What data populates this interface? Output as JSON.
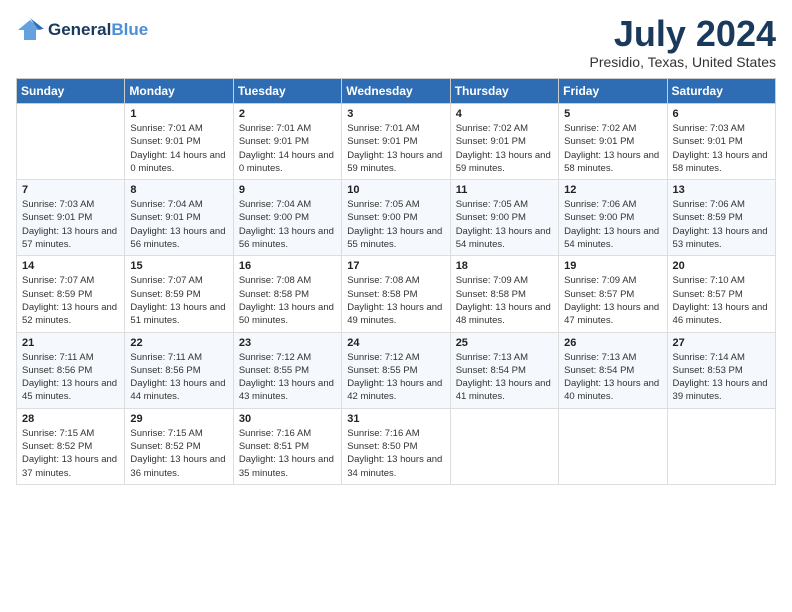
{
  "logo": {
    "line1": "General",
    "line2": "Blue"
  },
  "title": "July 2024",
  "location": "Presidio, Texas, United States",
  "days_of_week": [
    "Sunday",
    "Monday",
    "Tuesday",
    "Wednesday",
    "Thursday",
    "Friday",
    "Saturday"
  ],
  "weeks": [
    [
      {
        "day": "",
        "sunrise": "",
        "sunset": "",
        "daylight": ""
      },
      {
        "day": "1",
        "sunrise": "Sunrise: 7:01 AM",
        "sunset": "Sunset: 9:01 PM",
        "daylight": "Daylight: 14 hours and 0 minutes."
      },
      {
        "day": "2",
        "sunrise": "Sunrise: 7:01 AM",
        "sunset": "Sunset: 9:01 PM",
        "daylight": "Daylight: 14 hours and 0 minutes."
      },
      {
        "day": "3",
        "sunrise": "Sunrise: 7:01 AM",
        "sunset": "Sunset: 9:01 PM",
        "daylight": "Daylight: 13 hours and 59 minutes."
      },
      {
        "day": "4",
        "sunrise": "Sunrise: 7:02 AM",
        "sunset": "Sunset: 9:01 PM",
        "daylight": "Daylight: 13 hours and 59 minutes."
      },
      {
        "day": "5",
        "sunrise": "Sunrise: 7:02 AM",
        "sunset": "Sunset: 9:01 PM",
        "daylight": "Daylight: 13 hours and 58 minutes."
      },
      {
        "day": "6",
        "sunrise": "Sunrise: 7:03 AM",
        "sunset": "Sunset: 9:01 PM",
        "daylight": "Daylight: 13 hours and 58 minutes."
      }
    ],
    [
      {
        "day": "7",
        "sunrise": "Sunrise: 7:03 AM",
        "sunset": "Sunset: 9:01 PM",
        "daylight": "Daylight: 13 hours and 57 minutes."
      },
      {
        "day": "8",
        "sunrise": "Sunrise: 7:04 AM",
        "sunset": "Sunset: 9:01 PM",
        "daylight": "Daylight: 13 hours and 56 minutes."
      },
      {
        "day": "9",
        "sunrise": "Sunrise: 7:04 AM",
        "sunset": "Sunset: 9:00 PM",
        "daylight": "Daylight: 13 hours and 56 minutes."
      },
      {
        "day": "10",
        "sunrise": "Sunrise: 7:05 AM",
        "sunset": "Sunset: 9:00 PM",
        "daylight": "Daylight: 13 hours and 55 minutes."
      },
      {
        "day": "11",
        "sunrise": "Sunrise: 7:05 AM",
        "sunset": "Sunset: 9:00 PM",
        "daylight": "Daylight: 13 hours and 54 minutes."
      },
      {
        "day": "12",
        "sunrise": "Sunrise: 7:06 AM",
        "sunset": "Sunset: 9:00 PM",
        "daylight": "Daylight: 13 hours and 54 minutes."
      },
      {
        "day": "13",
        "sunrise": "Sunrise: 7:06 AM",
        "sunset": "Sunset: 8:59 PM",
        "daylight": "Daylight: 13 hours and 53 minutes."
      }
    ],
    [
      {
        "day": "14",
        "sunrise": "Sunrise: 7:07 AM",
        "sunset": "Sunset: 8:59 PM",
        "daylight": "Daylight: 13 hours and 52 minutes."
      },
      {
        "day": "15",
        "sunrise": "Sunrise: 7:07 AM",
        "sunset": "Sunset: 8:59 PM",
        "daylight": "Daylight: 13 hours and 51 minutes."
      },
      {
        "day": "16",
        "sunrise": "Sunrise: 7:08 AM",
        "sunset": "Sunset: 8:58 PM",
        "daylight": "Daylight: 13 hours and 50 minutes."
      },
      {
        "day": "17",
        "sunrise": "Sunrise: 7:08 AM",
        "sunset": "Sunset: 8:58 PM",
        "daylight": "Daylight: 13 hours and 49 minutes."
      },
      {
        "day": "18",
        "sunrise": "Sunrise: 7:09 AM",
        "sunset": "Sunset: 8:58 PM",
        "daylight": "Daylight: 13 hours and 48 minutes."
      },
      {
        "day": "19",
        "sunrise": "Sunrise: 7:09 AM",
        "sunset": "Sunset: 8:57 PM",
        "daylight": "Daylight: 13 hours and 47 minutes."
      },
      {
        "day": "20",
        "sunrise": "Sunrise: 7:10 AM",
        "sunset": "Sunset: 8:57 PM",
        "daylight": "Daylight: 13 hours and 46 minutes."
      }
    ],
    [
      {
        "day": "21",
        "sunrise": "Sunrise: 7:11 AM",
        "sunset": "Sunset: 8:56 PM",
        "daylight": "Daylight: 13 hours and 45 minutes."
      },
      {
        "day": "22",
        "sunrise": "Sunrise: 7:11 AM",
        "sunset": "Sunset: 8:56 PM",
        "daylight": "Daylight: 13 hours and 44 minutes."
      },
      {
        "day": "23",
        "sunrise": "Sunrise: 7:12 AM",
        "sunset": "Sunset: 8:55 PM",
        "daylight": "Daylight: 13 hours and 43 minutes."
      },
      {
        "day": "24",
        "sunrise": "Sunrise: 7:12 AM",
        "sunset": "Sunset: 8:55 PM",
        "daylight": "Daylight: 13 hours and 42 minutes."
      },
      {
        "day": "25",
        "sunrise": "Sunrise: 7:13 AM",
        "sunset": "Sunset: 8:54 PM",
        "daylight": "Daylight: 13 hours and 41 minutes."
      },
      {
        "day": "26",
        "sunrise": "Sunrise: 7:13 AM",
        "sunset": "Sunset: 8:54 PM",
        "daylight": "Daylight: 13 hours and 40 minutes."
      },
      {
        "day": "27",
        "sunrise": "Sunrise: 7:14 AM",
        "sunset": "Sunset: 8:53 PM",
        "daylight": "Daylight: 13 hours and 39 minutes."
      }
    ],
    [
      {
        "day": "28",
        "sunrise": "Sunrise: 7:15 AM",
        "sunset": "Sunset: 8:52 PM",
        "daylight": "Daylight: 13 hours and 37 minutes."
      },
      {
        "day": "29",
        "sunrise": "Sunrise: 7:15 AM",
        "sunset": "Sunset: 8:52 PM",
        "daylight": "Daylight: 13 hours and 36 minutes."
      },
      {
        "day": "30",
        "sunrise": "Sunrise: 7:16 AM",
        "sunset": "Sunset: 8:51 PM",
        "daylight": "Daylight: 13 hours and 35 minutes."
      },
      {
        "day": "31",
        "sunrise": "Sunrise: 7:16 AM",
        "sunset": "Sunset: 8:50 PM",
        "daylight": "Daylight: 13 hours and 34 minutes."
      },
      {
        "day": "",
        "sunrise": "",
        "sunset": "",
        "daylight": ""
      },
      {
        "day": "",
        "sunrise": "",
        "sunset": "",
        "daylight": ""
      },
      {
        "day": "",
        "sunrise": "",
        "sunset": "",
        "daylight": ""
      }
    ]
  ]
}
